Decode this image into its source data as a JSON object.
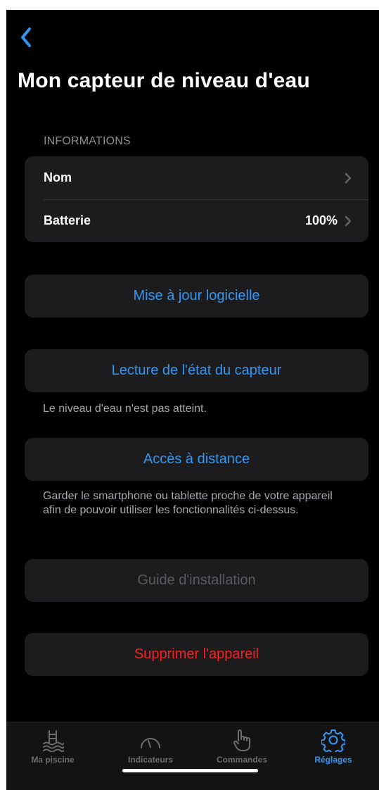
{
  "header": {
    "title": "Mon capteur de niveau d'eau"
  },
  "informations": {
    "header": "INFORMATIONS",
    "rows": [
      {
        "label": "Nom",
        "value": ""
      },
      {
        "label": "Batterie",
        "value": "100%"
      }
    ]
  },
  "actions": {
    "software_update": "Mise à jour logicielle",
    "read_state": "Lecture de l'état du capteur",
    "state_note": "Le niveau d'eau n'est pas atteint.",
    "remote_access": "Accès à distance",
    "remote_note": "Garder le smartphone ou tablette proche de votre appareil afin de pouvoir utiliser les fonctionnalités ci-dessus.",
    "install_guide": "Guide d'installation",
    "delete_device": "Supprimer l'appareil"
  },
  "tabbar": {
    "tabs": [
      {
        "label": "Ma piscine",
        "icon": "pool-ladder-icon",
        "active": false
      },
      {
        "label": "Indicateurs",
        "icon": "gauge-icon",
        "active": false
      },
      {
        "label": "Commandes",
        "icon": "hand-pointer-icon",
        "active": false
      },
      {
        "label": "Réglages",
        "icon": "gear-icon",
        "active": true
      }
    ]
  },
  "colors": {
    "background": "#000000",
    "cell": "#1c1c1e",
    "accent": "#2f97f5",
    "destructive": "#ff1e1e",
    "disabled": "#5a5a5e",
    "secondary_text": "#8e8e93"
  }
}
